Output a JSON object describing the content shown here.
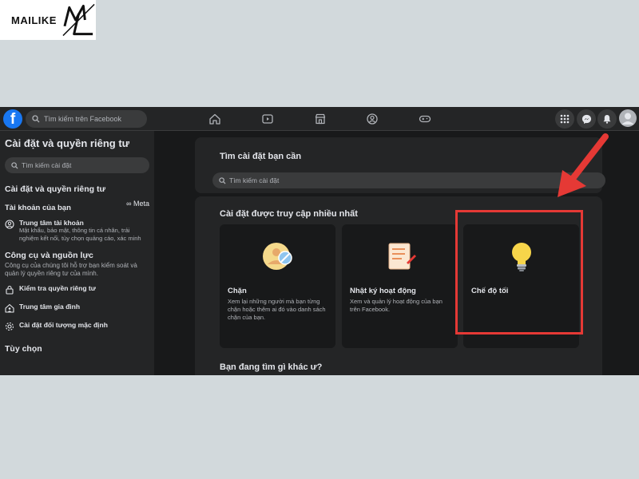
{
  "logo": {
    "text": "MAILIKE"
  },
  "topnav": {
    "search_placeholder": "Tìm kiếm trên Facebook"
  },
  "sidebar": {
    "title": "Cài đặt và quyền riêng tư",
    "search_placeholder": "Tìm kiếm cài đặt",
    "section1": "Cài đặt và quyền riêng tư",
    "account_heading": "Tài khoản của bạn",
    "meta_label": "Meta",
    "account_center": {
      "label": "Trung tâm tài khoản",
      "desc": "Mật khẩu, bảo mật, thông tin cá nhân, trải nghiệm kết nối, tùy chọn quảng cáo, xác minh"
    },
    "tools_heading": "Công cụ và nguồn lực",
    "tools_desc": "Công cụ của chúng tôi hỗ trợ bạn kiểm soát và quản lý quyền riêng tư của mình.",
    "items": [
      {
        "label": "Kiểm tra quyền riêng tư",
        "icon": "lock-icon"
      },
      {
        "label": "Trung tâm gia đình",
        "icon": "family-icon"
      },
      {
        "label": "Cài đặt đối tượng mặc định",
        "icon": "gear-icon"
      }
    ],
    "options_heading": "Tùy chọn"
  },
  "main": {
    "search_title": "Tìm cài đặt bạn cần",
    "search_placeholder": "Tìm kiếm cài đặt",
    "frequent_title": "Cài đặt được truy cập nhiều nhất",
    "cards": [
      {
        "title": "Chặn",
        "desc": "Xem lại những người mà bạn từng chặn hoặc thêm ai đó vào danh sách chặn của bạn.",
        "icon": "block-person-icon"
      },
      {
        "title": "Nhật ký hoạt động",
        "desc": "Xem và quản lý hoạt động của bạn trên Facebook.",
        "icon": "activity-log-icon"
      },
      {
        "title": "Chế độ tối",
        "desc": "",
        "icon": "lightbulb-icon"
      }
    ],
    "other_title": "Bạn đang tìm gì khác ư?"
  },
  "colors": {
    "accent": "#1877f2",
    "highlight": "#e53935",
    "background": "#18191a",
    "panel": "#242526"
  }
}
